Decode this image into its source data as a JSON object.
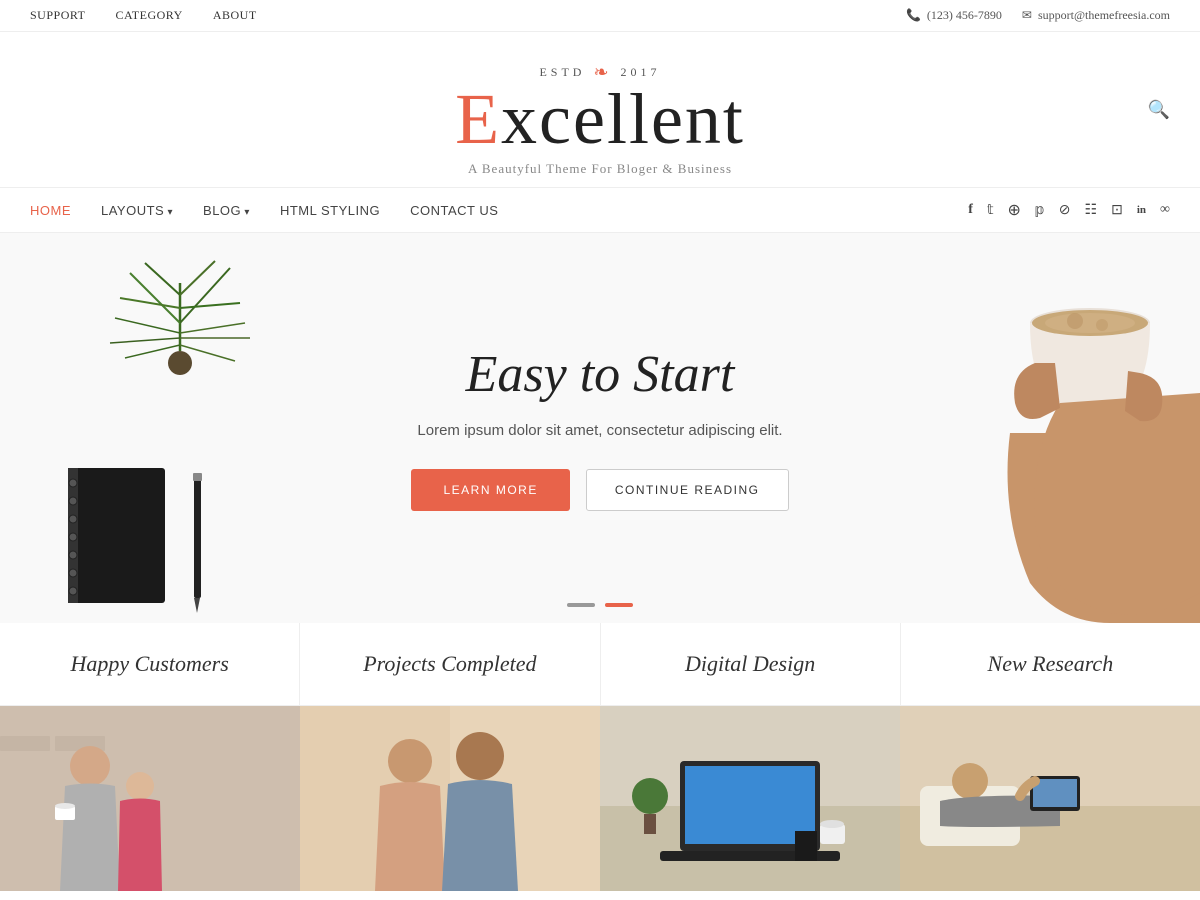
{
  "topbar": {
    "nav": [
      {
        "label": "SUPPORT",
        "href": "#"
      },
      {
        "label": "CATEGORY",
        "href": "#"
      },
      {
        "label": "ABOUT",
        "href": "#"
      }
    ],
    "phone": "(123) 456-7890",
    "email": "support@themefreesia.com"
  },
  "header": {
    "estd_label": "ESTD",
    "year": "2017",
    "logo_first": "E",
    "logo_rest": "xcellent",
    "tagline": "A Beautyful Theme For Bloger & Business"
  },
  "nav": {
    "links": [
      {
        "label": "HOME",
        "active": true
      },
      {
        "label": "LAYOUTS",
        "dropdown": true
      },
      {
        "label": "BLOG",
        "dropdown": true
      },
      {
        "label": "HTML STYLING"
      },
      {
        "label": "CONTACT US"
      }
    ],
    "social": [
      {
        "icon": "f",
        "name": "facebook"
      },
      {
        "icon": "t",
        "name": "twitter"
      },
      {
        "icon": "♻",
        "name": "google-plus"
      },
      {
        "icon": "p",
        "name": "pinterest"
      },
      {
        "icon": "d",
        "name": "dribbble"
      },
      {
        "icon": "☷",
        "name": "instagram"
      },
      {
        "icon": "⊡",
        "name": "flickr"
      },
      {
        "icon": "in",
        "name": "linkedin"
      },
      {
        "icon": "∞",
        "name": "link"
      }
    ]
  },
  "hero": {
    "title": "Easy to Start",
    "text": "Lorem ipsum dolor sit amet, consectetur adipiscing elit.",
    "btn_learn": "LEARN MORE",
    "btn_continue": "CONTINUE READING",
    "dots": [
      false,
      true
    ]
  },
  "stats": [
    {
      "label": "Happy Customers"
    },
    {
      "label": "Projects Completed"
    },
    {
      "label": "Digital Design"
    },
    {
      "label": "New Research"
    }
  ],
  "image_grid": [
    {
      "alt": "Family photo"
    },
    {
      "alt": "Couple photo"
    },
    {
      "alt": "Laptop photo"
    },
    {
      "alt": "Reading photo"
    }
  ]
}
